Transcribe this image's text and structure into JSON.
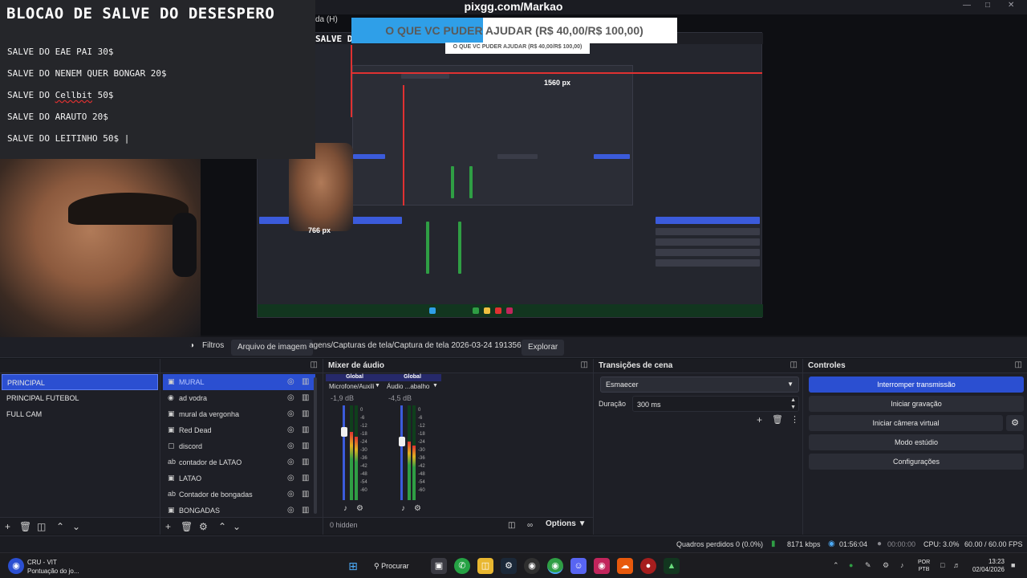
{
  "window": {
    "site_title": "pixgg.com/Markao",
    "menu_fragment": "da (H)"
  },
  "overlay": {
    "title": "BLOCAO DE SALVE DO DESESPERO",
    "lines": [
      {
        "prefix": "SALVE DO EAE PAI 30$",
        "under": "",
        "suffix": ""
      },
      {
        "prefix": "SALVE DO NENEM QUER BONGAR 20$",
        "under": "",
        "suffix": ""
      },
      {
        "prefix": "SALVE DO ",
        "under": "Cellbit",
        "suffix": " 50$"
      },
      {
        "prefix": "SALVE DO ARAUTO 20$",
        "under": "",
        "suffix": ""
      },
      {
        "prefix": "SALVE DO LEITINHO 50$ |",
        "under": "",
        "suffix": ""
      }
    ],
    "salve_fragment": "SALVE D"
  },
  "banner": {
    "text": "O QUE VC PUDER AJUDAR (R$ 40,00/R$ 100,00)",
    "small_text": "O QUE VC PUDER AJUDAR (R$ 40,00/R$ 100,00)"
  },
  "preview_labels": {
    "width_label": "1560 px",
    "height_label": "766 px"
  },
  "source_toolbar": {
    "filters": "Filtros",
    "image_file": "Arquivo de imagem",
    "path": "agens/Capturas de tela/Captura de tela 2026-03-24 191356.png",
    "explore": "Explorar"
  },
  "scenes": {
    "items": [
      "PRINCIPAL",
      "PRINCIPAL FUTEBOL",
      "FULL CAM"
    ],
    "selected": 0
  },
  "sources": {
    "items": [
      {
        "label": "MURAL",
        "icon": "image-icon"
      },
      {
        "label": "ad vodra",
        "icon": "browser-icon"
      },
      {
        "label": "mural da vergonha",
        "icon": "image-icon"
      },
      {
        "label": "Red Dead",
        "icon": "image-icon"
      },
      {
        "label": "discord",
        "icon": "window-icon"
      },
      {
        "label": "contador de LATAO",
        "icon": "text-icon"
      },
      {
        "label": "LATAO",
        "icon": "image-icon"
      },
      {
        "label": "Contador de bongadas",
        "icon": "text-icon"
      },
      {
        "label": "BONGADAS",
        "icon": "image-icon"
      }
    ],
    "selected": 0
  },
  "mixer": {
    "title": "Mixer de áudio",
    "channels": [
      {
        "scope": "Global",
        "name": "Microfone/Auxili",
        "db": "-1,9 dB",
        "level": 0.72
      },
      {
        "scope": "Global",
        "name": "Áudio ...abalho",
        "db": "-4,5 dB",
        "level": 0.62
      }
    ],
    "ticks": [
      "0",
      "-6",
      "-12",
      "-18",
      "-24",
      "-30",
      "-36",
      "-42",
      "-48",
      "-54",
      "-60"
    ],
    "hidden_label": "0 hidden",
    "options_label": "Options"
  },
  "transitions": {
    "title": "Transições de cena",
    "selected": "Esmaecer",
    "duration_label": "Duração",
    "duration_value": "300 ms"
  },
  "controls": {
    "title": "Controles",
    "buttons": [
      "Interromper transmissão",
      "Iniciar gravação",
      "Iniciar câmera virtual",
      "Modo estúdio",
      "Configurações"
    ]
  },
  "status": {
    "dropped": "Quadros perdidos 0 (0.0%)",
    "bitrate": "8171 kbps",
    "stream_time": "01:56:04",
    "rec_time": "00:00:00",
    "cpu": "CPU: 3.0%",
    "fps": "60.00 / 60.00 FPS"
  },
  "taskbar": {
    "weather_title": "CRU - VIT",
    "weather_sub": "Pontuação do jo...",
    "search": "Procurar",
    "lang_top": "POR",
    "lang_bottom": "PTB",
    "time": "13:23",
    "date": "02/04/2026"
  },
  "colors": {
    "accent": "#2b4fd1",
    "banner_blue": "#2f9fe8",
    "meter_green": "#2f9e44",
    "guide_red": "#e03131"
  }
}
